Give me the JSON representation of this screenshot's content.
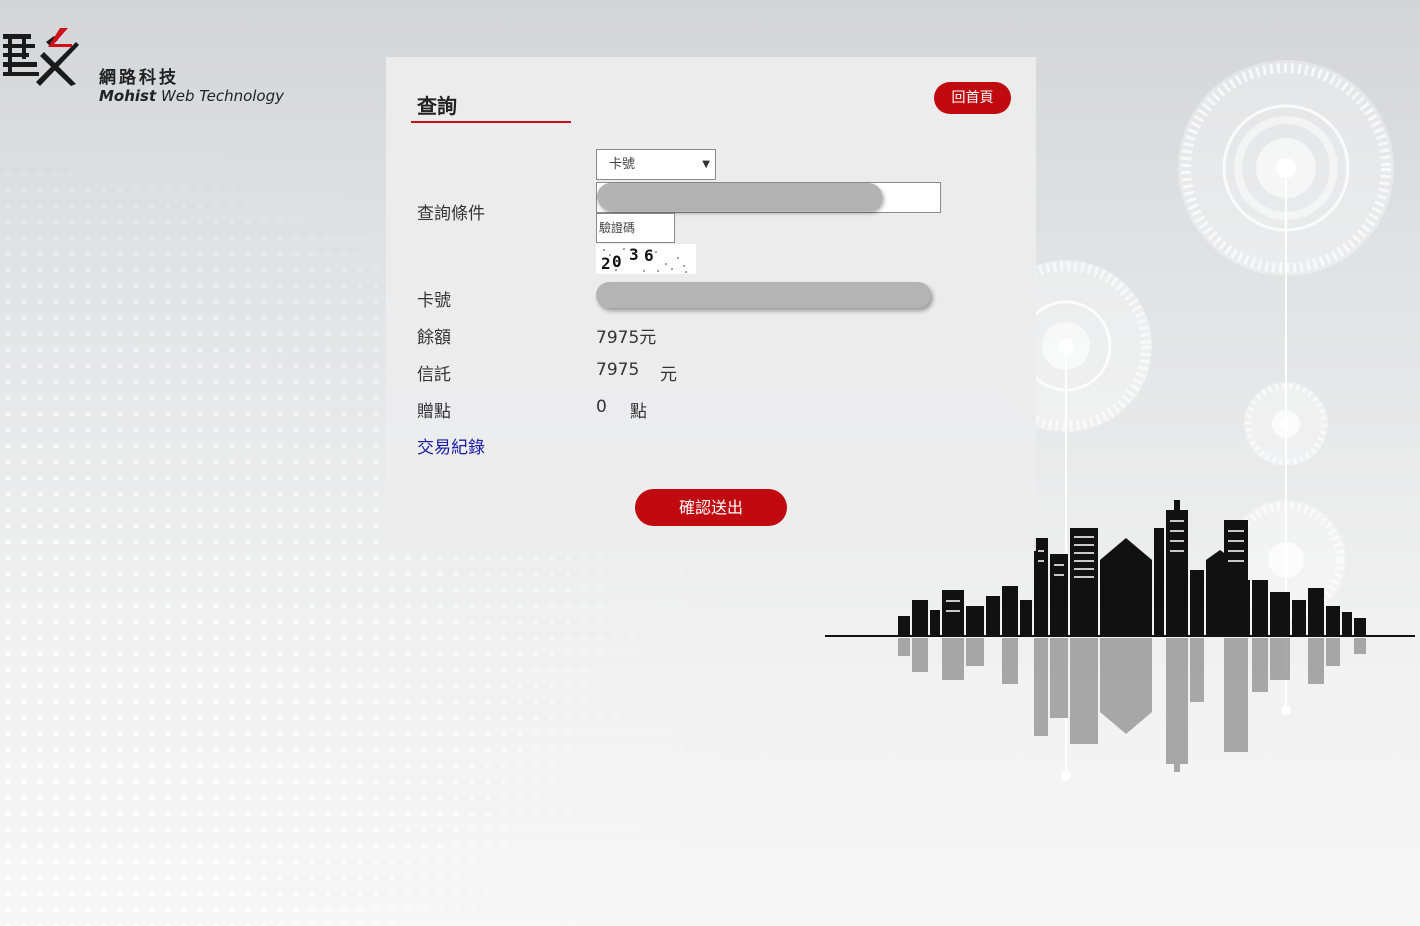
{
  "brand": {
    "name_cn": "網路科技",
    "name_en_bold": "Mohist",
    "name_en_rest": "Web Technology"
  },
  "panel": {
    "title": "查詢",
    "home_button": "回首頁",
    "query_label": "查詢條件",
    "select_value": "卡號",
    "captcha_placeholder": "驗證碼",
    "captcha_code": "2036",
    "card_label": "卡號",
    "balance_label": "餘額",
    "balance_value": "7975元",
    "trust_label": "信託",
    "trust_value": "7975",
    "trust_unit": "元",
    "bonus_label": "贈點",
    "bonus_value": "0",
    "bonus_unit": "點",
    "history_link": "交易紀錄",
    "submit_button": "確認送出"
  },
  "colors": {
    "accent": "#c10a10",
    "link": "#1a1aa6"
  }
}
